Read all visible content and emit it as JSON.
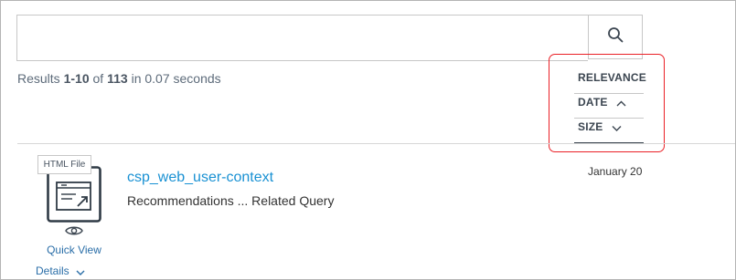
{
  "search": {
    "value": "",
    "placeholder": ""
  },
  "summary": {
    "prefix": "Results ",
    "range_start": "1",
    "range_sep": "-",
    "range_end": "10",
    "of_text": " of ",
    "total": "113",
    "time_text": " in 0.07 seconds"
  },
  "sort": {
    "relevance_label": "RELEVANCE",
    "date_label": "DATE",
    "size_label": "SIZE",
    "highlight_color": "#ea2026"
  },
  "result": {
    "type_badge": "HTML File",
    "title": "csp_web_user-context",
    "excerpt": "Recommendations ... Related Query",
    "date": "January 20",
    "quick_view_label": "Quick View",
    "details_label": "Details"
  },
  "icons": {
    "search": "search-icon",
    "date_sort": "chevron-up-icon",
    "size_sort": "chevron-down-icon",
    "file": "html-file-icon",
    "quick_view": "eye-icon",
    "details": "chevron-down-icon"
  },
  "colors": {
    "link": "#1991d3",
    "secondary_link": "#2a6ea8",
    "muted_text": "#5d6b7a"
  }
}
